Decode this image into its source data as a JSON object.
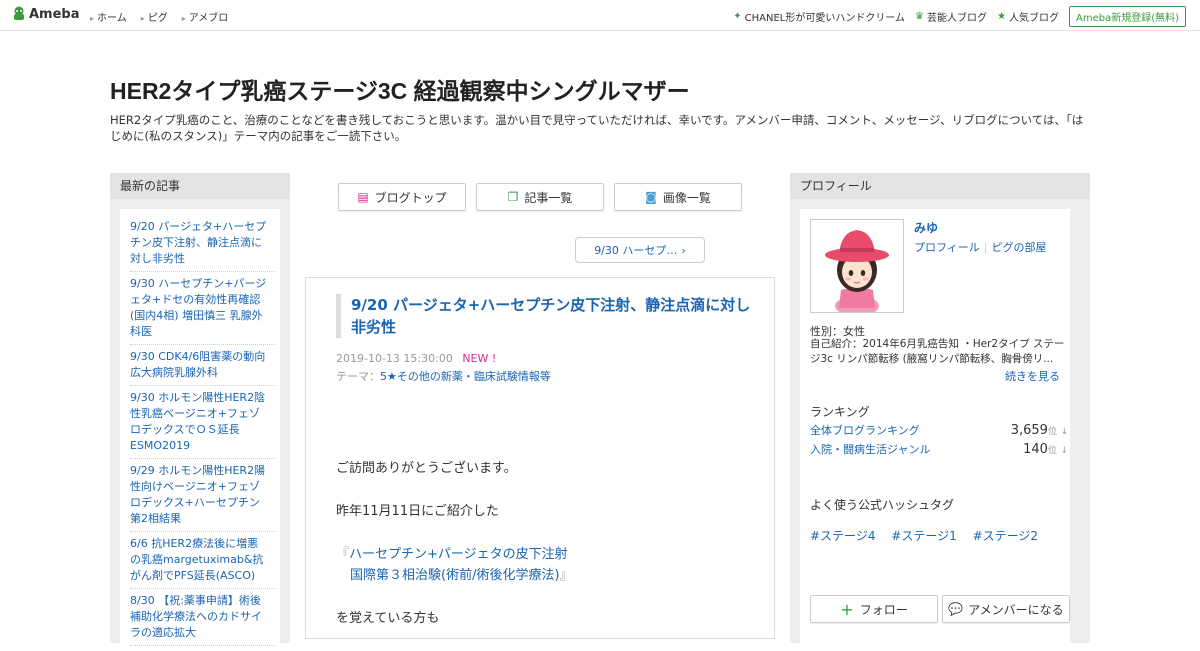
{
  "topbar": {
    "logo_text": "Ameba",
    "nav": [
      "ホーム",
      "ピグ",
      "アメブロ"
    ],
    "right_links": [
      {
        "label": "CHANEL形が可愛いハンドクリーム",
        "icon": "sparkle-icon"
      },
      {
        "label": "芸能人ブログ",
        "icon": "crown-icon"
      },
      {
        "label": "人気ブログ",
        "icon": "star-icon"
      }
    ],
    "register_label": "Ameba新規登録(無料)",
    "accent": "#3a9c3f"
  },
  "blog": {
    "title": "HER2タイプ乳癌ステージ3C 経過観察中シングルマザー",
    "description": "HER2タイプ乳癌のこと、治療のことなどを書き残しておこうと思います。温かい目で見守っていただければ、幸いです。アメンバー申請、コメント、メッセージ、リブログについては、「はじめに(私のスタンス)」テーマ内の記事をご一読下さい。"
  },
  "left": {
    "heading": "最新の記事",
    "recent": [
      "9/20 パージェタ+ハーセプチン皮下注射、静注点滴に対し非劣性",
      "9/30 ハーセプチン+パージェタ+ドセの有効性再確認(国内4相) 増田慎三 乳腺外科医",
      "9/30 CDK4/6阻害薬の動向 広大病院乳腺外科",
      "9/30 ホルモン陽性HER2陰性乳癌ベージニオ+フェゾロデックスでＯＳ延長 ESMO2019",
      "9/29 ホルモン陽性HER2陽性向けベージニオ+フェゾロデックス+ハーセプチン第2相結果",
      "6/6 抗HER2療法後に増悪の乳癌margetuximab&抗がん剤でPFS延長(ASCO)",
      "8/30 【祝:薬事申請】術後補助化学療法へのカドサイラの適応拡大"
    ]
  },
  "center": {
    "buttons": [
      {
        "label": "ブログトップ",
        "icon": "document-icon"
      },
      {
        "label": "記事一覧",
        "icon": "list-icon"
      },
      {
        "label": "画像一覧",
        "icon": "camera-icon"
      }
    ],
    "pager_label": "9/30 ハーセプ…",
    "article": {
      "title": "9/20 パージェタ+ハーセプチン皮下注射、静注点滴に対し非劣性",
      "date": "2019-10-13 15:30:00",
      "new_label": "NEW !",
      "theme_prefix": "テーマ：",
      "theme": "5★その他の新薬・臨床試験情報等",
      "body": {
        "p1": "ご訪問ありがとうございます。",
        "p2": "昨年11月11日にご紹介した",
        "link_open": "『",
        "link_line1": "ハーセプチン+パージェタの皮下注射",
        "link_line2": "国際第３相治験(術前/術後化学療法)",
        "link_close": "』",
        "p3": "を覚えている方も"
      }
    }
  },
  "right": {
    "heading": "プロフィール",
    "name": "みゆ",
    "link_profile": "プロフィール",
    "link_separator": "|",
    "link_pig": "ピグの部屋",
    "gender": "性別：女性",
    "intro": "自己紹介：2014年6月乳癌告知 ・Her2タイプ ステージ3c リンパ節転移 (腋窩リンパ節転移、胸骨傍リ...",
    "more": "続きを見る",
    "ranking_title": "ランキング",
    "ranking": [
      {
        "label": "全体ブログランキング",
        "value": "3,659",
        "unit": "位",
        "arrow": "↓"
      },
      {
        "label": "入院・闘病生活ジャンル",
        "value": "140",
        "unit": "位",
        "arrow": "↓"
      }
    ],
    "hashtag_title": "よく使う公式ハッシュタグ",
    "hashtags": [
      "#ステージ4",
      "#ステージ1",
      "#ステージ2"
    ],
    "follow_label": "フォロー",
    "amember_label": "アメンバーになる"
  }
}
